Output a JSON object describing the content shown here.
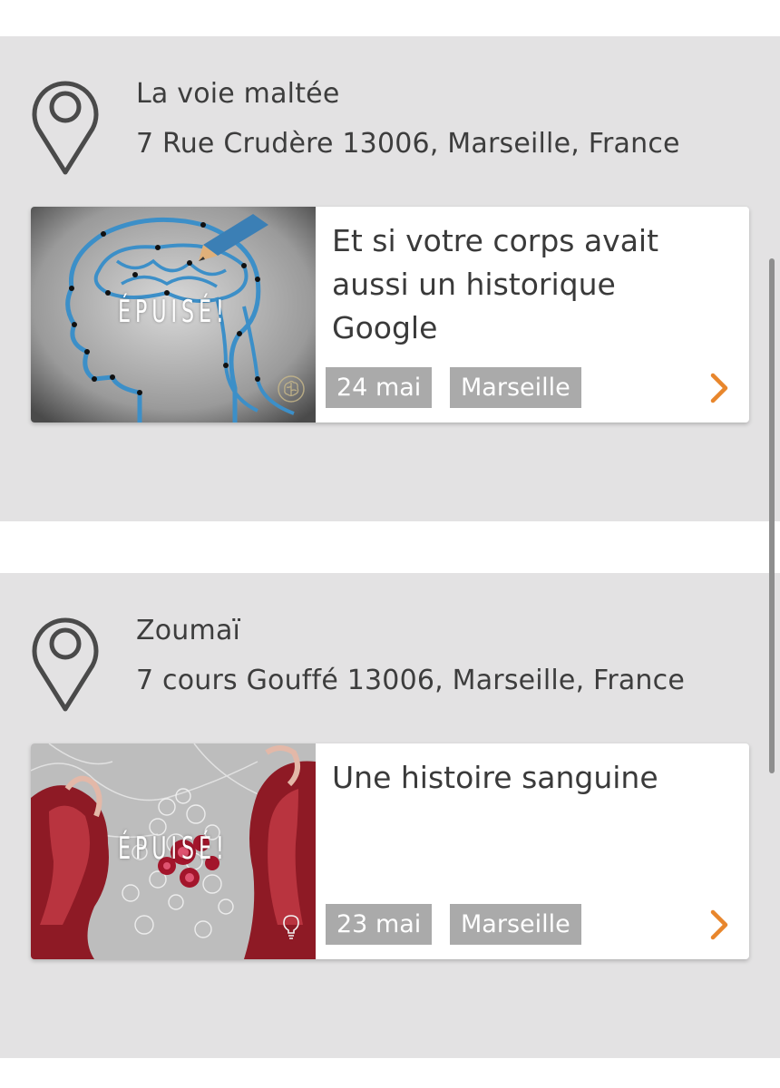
{
  "venues": [
    {
      "name": "La voie maltée",
      "address": "7 Rue Crudère 13006, Marseille, France",
      "event": {
        "title": "Et si votre corps avait aussi un historique Google",
        "status": "ÉPUISÉ!",
        "date": "24 mai",
        "city": "Marseille",
        "thumbnail": "dot-to-dot-brain-head-drawing",
        "badge_icon": "brain-icon"
      }
    },
    {
      "name": "Zoumaï",
      "address": "7 cours Gouffé 13006, Marseille, France",
      "event": {
        "title": "Une histoire sanguine",
        "status": "ÉPUISÉ!",
        "date": "23 mai",
        "city": "Marseille",
        "thumbnail": "anatomical-blood-vessels-illustration",
        "badge_icon": "lightbulb-icon"
      }
    }
  ],
  "icons": {
    "location": "location-pin-icon",
    "next": "chevron-right-icon"
  },
  "colors": {
    "section_bg": "#e3e2e3",
    "tag_bg": "#aaaaaa",
    "accent": "#e8862c",
    "text": "#3d3d3d"
  }
}
